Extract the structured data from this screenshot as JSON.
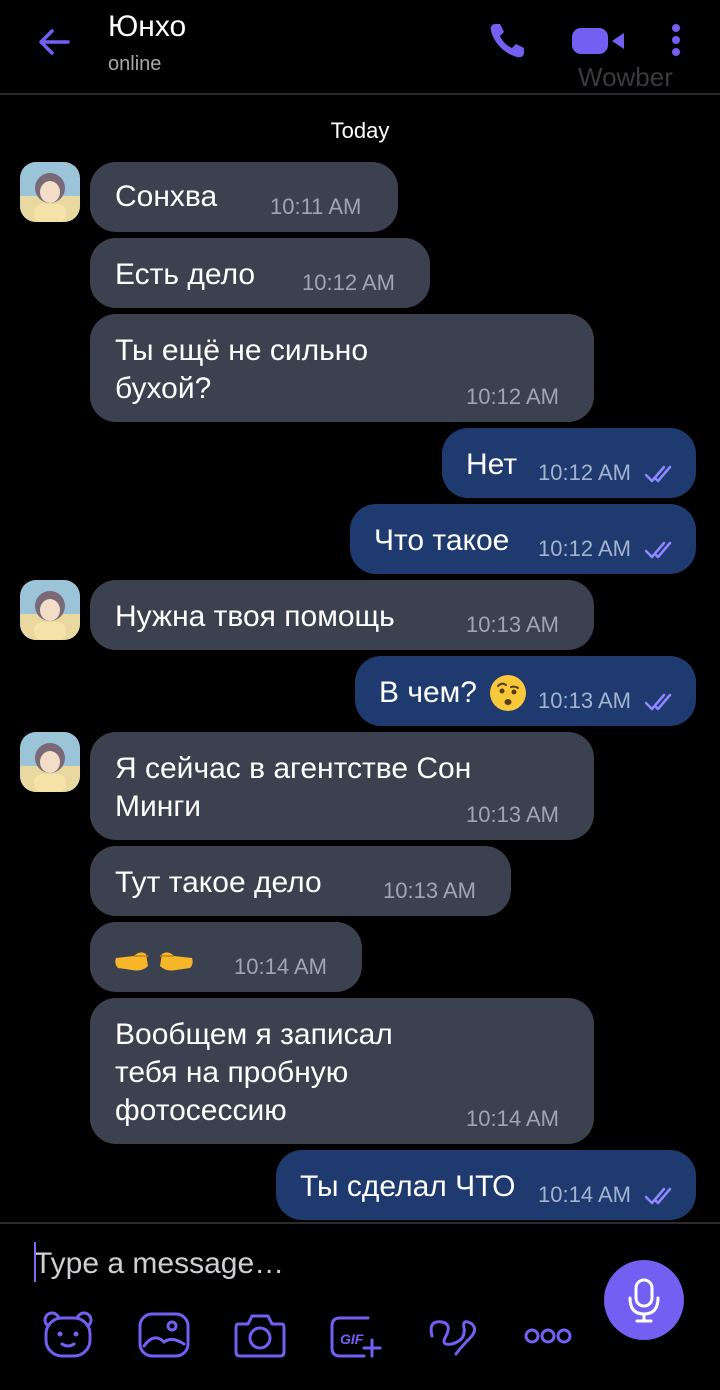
{
  "header": {
    "contact_name": "Юнхо",
    "status": "online",
    "watermark": "Wowber"
  },
  "chat": {
    "date_label": "Today",
    "messages": [
      {
        "dir": "in",
        "text": "Сонхва",
        "time": "10:11 AM"
      },
      {
        "dir": "in",
        "text": "Есть дело",
        "time": "10:12 AM"
      },
      {
        "dir": "in",
        "text_lines": [
          "Ты ещё не сильно",
          "бухой?"
        ],
        "time": "10:12 AM"
      },
      {
        "dir": "out",
        "text": "Нет",
        "time": "10:12 AM",
        "status": "read"
      },
      {
        "dir": "out",
        "text": "Что такое",
        "time": "10:12 AM",
        "status": "read"
      },
      {
        "dir": "in",
        "text": "Нужна твоя помощь",
        "time": "10:13 AM"
      },
      {
        "dir": "out",
        "text": "В чем?",
        "emoji": "face-with-raised-eyebrow",
        "time": "10:13 AM",
        "status": "read"
      },
      {
        "dir": "in",
        "text_lines": [
          "Я сейчас в агентстве Сон",
          "Минги"
        ],
        "time": "10:13 AM"
      },
      {
        "dir": "in",
        "text": "Тут такое дело",
        "time": "10:13 AM"
      },
      {
        "dir": "in",
        "emoji": "pointing-fingers-each-other",
        "time": "10:14 AM"
      },
      {
        "dir": "in",
        "text_lines": [
          "Вообщем я записал",
          "тебя на пробную",
          "фотосессию"
        ],
        "time": "10:14 AM"
      },
      {
        "dir": "out",
        "text": "Ты сделал ЧТО",
        "time": "10:14 AM",
        "status": "read"
      }
    ]
  },
  "composer": {
    "placeholder": "Type a message…",
    "tools": [
      "sticker-bear-icon",
      "gallery-icon",
      "camera-icon",
      "gif-icon",
      "doodle-icon",
      "more-dots-icon"
    ]
  },
  "colors": {
    "accent": "#7360f2",
    "incoming_bubble": "#3c4150",
    "outgoing_bubble": "#1e3a6e",
    "read_ticks": "#8f87ff"
  }
}
